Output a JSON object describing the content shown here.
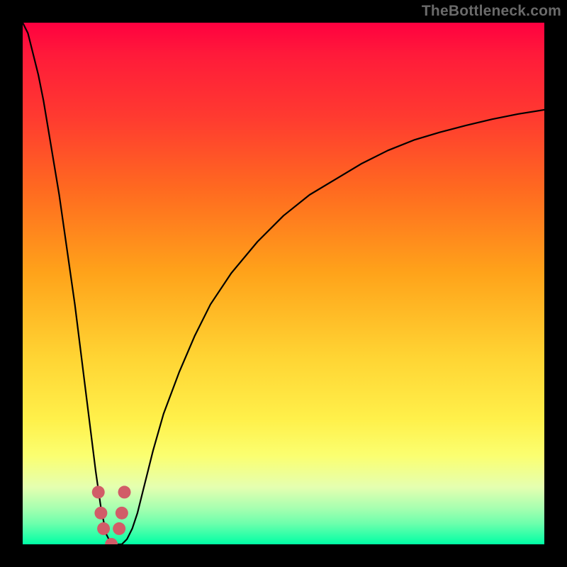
{
  "watermark": "TheBottleneck.com",
  "colors": {
    "frame": "#000000",
    "curve": "#000000",
    "marker_fill": "#d15c68",
    "marker_stroke": "#d15c68",
    "gradient_top": "#ff0040",
    "gradient_bottom": "#00ffa5"
  },
  "chart_data": {
    "type": "line",
    "title": "",
    "xlabel": "",
    "ylabel": "",
    "xlim": [
      0,
      100
    ],
    "ylim": [
      0,
      100
    ],
    "grid": false,
    "legend": false,
    "x": [
      0,
      1,
      2,
      3,
      4,
      5,
      6,
      7,
      8,
      9,
      10,
      11,
      12,
      13,
      14,
      15,
      16,
      17,
      18,
      19,
      20,
      21,
      22,
      23,
      24,
      25,
      27,
      30,
      33,
      36,
      40,
      45,
      50,
      55,
      60,
      65,
      70,
      75,
      80,
      85,
      90,
      95,
      100
    ],
    "values": [
      100,
      98,
      94,
      90,
      85,
      79,
      73,
      67,
      60,
      53,
      46,
      38,
      30,
      22,
      14,
      7,
      2,
      0,
      0,
      0,
      1,
      3,
      6,
      10,
      14,
      18,
      25,
      33,
      40,
      46,
      52,
      58,
      63,
      67,
      70,
      73,
      75.5,
      77.5,
      79,
      80.3,
      81.5,
      82.5,
      83.3
    ],
    "markers_x": [
      14.5,
      15,
      15.5,
      17,
      18.5,
      19,
      19.5
    ],
    "markers_y": [
      10,
      6,
      3,
      0,
      3,
      6,
      10
    ]
  }
}
